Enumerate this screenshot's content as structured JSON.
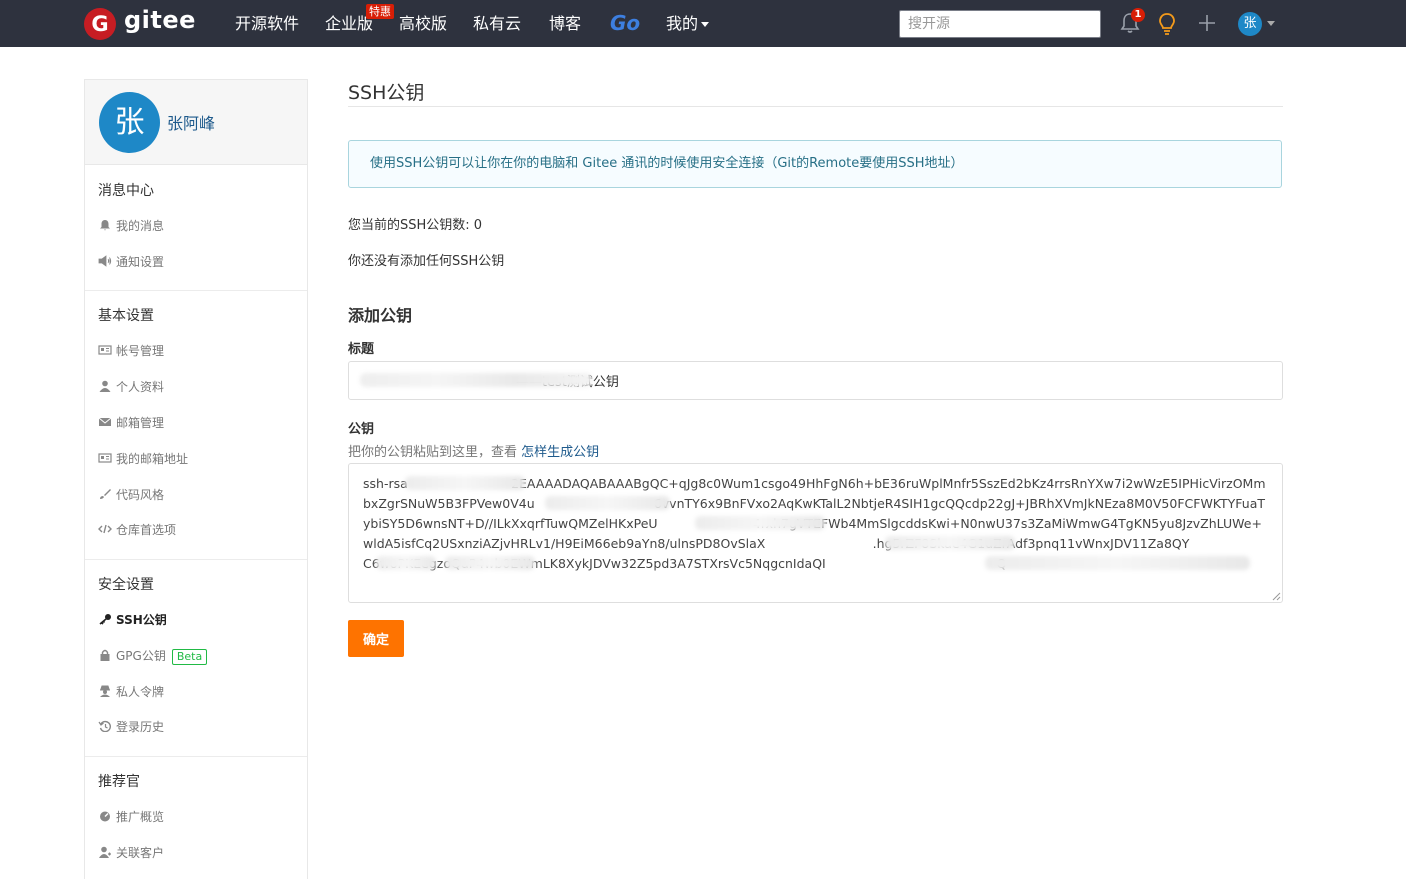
{
  "nav": {
    "logo_letter": "G",
    "logo_text": "gitee",
    "items": [
      "开源软件",
      "企业版",
      "高校版",
      "私有云",
      "博客"
    ],
    "hot_badge": "特惠",
    "go_label": "Go",
    "mine_label": "我的",
    "search_placeholder": "搜开源",
    "notification_count": "1",
    "avatar_letter": "张"
  },
  "sidebar": {
    "avatar_letter": "张",
    "username": "张阿峰",
    "sections": [
      {
        "title": "消息中心",
        "items": [
          "我的消息",
          "通知设置"
        ]
      },
      {
        "title": "基本设置",
        "items": [
          "帐号管理",
          "个人资料",
          "邮箱管理",
          "我的邮箱地址",
          "代码风格",
          "仓库首选项"
        ]
      },
      {
        "title": "安全设置",
        "items": [
          "SSH公钥",
          "GPG公钥",
          "私人令牌",
          "登录历史"
        ]
      },
      {
        "title": "推荐官",
        "items": [
          "推广概览",
          "关联客户"
        ]
      }
    ],
    "beta_label": "Beta"
  },
  "main": {
    "page_title": "SSH公钥",
    "info": "使用SSH公钥可以让你在你的电脑和 Gitee 通讯的时候使用安全连接（Git的Remote要使用SSH地址）",
    "count_text": "您当前的SSH公钥数: 0",
    "none_text": "你还没有添加任何SSH公钥",
    "add_title": "添加公钥",
    "title_label": "标题",
    "title_value": "                                     ——test测试公钥",
    "key_label": "公钥",
    "key_hint": "把你的公钥粘贴到这里，查看 ",
    "key_hint_link": "怎样生成公钥",
    "key_value": "ssh-rsa                          2EAAAADAQABAAABgQC+qJg8c0Wum1csgo49HhFgN6h+bE36ruWplMnfr5SszEd2bKz4rrsRnYXw7i2wWzE5IPHicVirzOMmbxZgrSNuW5B3FPVew0V4u                              6vvnTY6x9BnFVxo2AqKwKTalL2NbtjeR4SIH1gcQQcdp22gJ+JBRhXVmJkNEza8M0V50FCFWKTYFuaTybiSY5D6wnsNT+D//ILkXxqrfTuwQMZelHKxPeU                        4rxh7gVTEFWb4MmSlgcddsKwi+N0nwU37s3ZaMiWmwG4TgKN5yu8JzvZhLUWe+wldA5isfCq2USxnziAZjvHRLv1/H9EiM66eb9aYn8/ulnsPD8OvSlaX                           .hg5rZF8Skae4G1uZrAdf3pnq11vWnxJDV11Za8QY                        C6woPKEegzoQuP4wb0EWmLK8XykJDVw32Z5pd3A7STXrsVc5NqgcnIdaQI                                           Q",
    "submit_label": "确定"
  }
}
